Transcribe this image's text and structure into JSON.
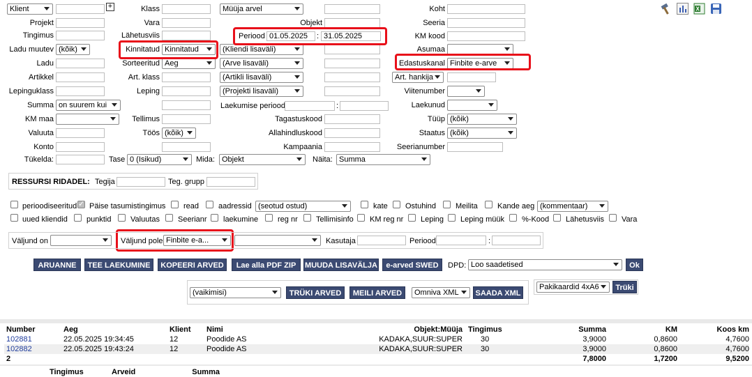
{
  "filters": {
    "klient": {
      "label": "Klient",
      "value": ""
    },
    "projekt": {
      "label": "Projekt",
      "value": ""
    },
    "tingimus": {
      "label": "Tingimus",
      "value": ""
    },
    "ladu_muutev": {
      "label": "Ladu muutev",
      "value": "(kõik)"
    },
    "ladu": {
      "label": "Ladu",
      "value": ""
    },
    "artikkel": {
      "label": "Artikkel",
      "value": ""
    },
    "lepinguklass": {
      "label": "Lepinguklass",
      "value": ""
    },
    "summa": {
      "label": "Summa",
      "value": "on suurem kui"
    },
    "km_maa": {
      "label": "KM maa",
      "value": ""
    },
    "valuuta": {
      "label": "Valuuta",
      "value": ""
    },
    "konto": {
      "label": "Konto",
      "value": ""
    },
    "klass": {
      "label": "Klass",
      "value": ""
    },
    "vara": {
      "label": "Vara",
      "value": ""
    },
    "lahetusviis": {
      "label": "Lähetusviis",
      "value": ""
    },
    "kinnitatud": {
      "label": "Kinnitatud",
      "value": "Kinnitatud"
    },
    "sorteeritud": {
      "label": "Sorteeritud",
      "value": "Aeg"
    },
    "art_klass": {
      "label": "Art. klass",
      "value": ""
    },
    "leping": {
      "label": "Leping",
      "value": ""
    },
    "tellimus": {
      "label": "Tellimus",
      "value": ""
    },
    "toos": {
      "label": "Töös",
      "value": "(kõik)"
    },
    "muuja_arvel": {
      "value": "Müüja arvel"
    },
    "objekt": {
      "label": "Objekt",
      "value": ""
    },
    "periood": {
      "label": "Periood",
      "from": "01.05.2025",
      "to": "31.05.2025"
    },
    "kliendi_lisavali": {
      "value": "(Kliendi lisaväli)"
    },
    "arve_lisavali": {
      "value": "(Arve lisaväli)"
    },
    "artikli_lisavali": {
      "value": "(Artikli lisaväli)"
    },
    "projekti_lisavali": {
      "value": "(Projekti lisaväli)"
    },
    "laekumise_periood": {
      "label": "Laekumise periood"
    },
    "tagastuskood": {
      "label": "Tagastuskood"
    },
    "allahindluskood": {
      "label": "Allahindluskood"
    },
    "kampaania": {
      "label": "Kampaania"
    },
    "koht": {
      "label": "Koht"
    },
    "seeria": {
      "label": "Seeria"
    },
    "km_kood": {
      "label": "KM kood"
    },
    "asumaa": {
      "label": "Asumaa",
      "value": ""
    },
    "edastuskanal": {
      "label": "Edastuskanal",
      "value": "Finbite e-arve"
    },
    "art_hankija": {
      "value": "Art. hankija"
    },
    "viitenumber": {
      "label": "Viitenumber",
      "value": ""
    },
    "laekunud": {
      "label": "Laekunud",
      "value": ""
    },
    "tuup": {
      "label": "Tüüp",
      "value": "(kõik)"
    },
    "staatus": {
      "label": "Staatus",
      "value": "(kõik)"
    },
    "seerianumber": {
      "label": "Seerianumber"
    },
    "tukelda": {
      "label": "Tükelda:",
      "value": ""
    },
    "tase": {
      "label": "Tase",
      "value": "0 (Isikud)"
    },
    "mida": {
      "label": "Mida:",
      "value": "Objekt"
    },
    "naita": {
      "label": "Näita:",
      "value": "Summa"
    }
  },
  "ressursi": {
    "title": "RESSURSI RIDADEL:",
    "tegija": "Tegija",
    "teg_grupp": "Teg. grupp"
  },
  "options": {
    "row1": [
      {
        "label": "perioodiseeritud",
        "checked": false
      },
      {
        "label": "Päise tasumistingimus",
        "checked": true
      },
      {
        "label": "read",
        "checked": false
      },
      {
        "label": "aadressid",
        "checked": false
      },
      {
        "label": "kate",
        "checked": false
      },
      {
        "label": "Ostuhind",
        "checked": false
      },
      {
        "label": "Meilita",
        "checked": false
      },
      {
        "label": "Kande aeg",
        "checked": false
      }
    ],
    "seotud_ostud": "(seotud ostud)",
    "kommentaar": "(kommentaar)",
    "row2": [
      {
        "label": "uued kliendid",
        "checked": false
      },
      {
        "label": "punktid",
        "checked": false
      },
      {
        "label": "Valuutas",
        "checked": false
      },
      {
        "label": "Seerianr",
        "checked": false
      },
      {
        "label": "laekumine",
        "checked": false
      },
      {
        "label": "reg nr",
        "checked": false
      },
      {
        "label": "Tellimisinfo",
        "checked": false
      },
      {
        "label": "KM reg nr",
        "checked": false
      },
      {
        "label": "Leping",
        "checked": false
      },
      {
        "label": "Leping müük",
        "checked": false
      },
      {
        "label": "%-Kood",
        "checked": false
      },
      {
        "label": "Lähetusviis",
        "checked": false
      },
      {
        "label": "Vara",
        "checked": false
      }
    ]
  },
  "output": {
    "valjund_on": "Väljund on",
    "valjund_on_value": "",
    "valjund_pole": "Väljund pole",
    "valjund_pole_value": "Finbite e-a...",
    "extra_value": "",
    "kasutaja": "Kasutaja",
    "periood": "Periood"
  },
  "actions": {
    "aruanne": "ARUANNE",
    "tee_laekumine": "TEE LAEKUMINE",
    "kopeeri_arved": "KOPEERI ARVED",
    "lae_alla_pdf": "Lae alla PDF ZIP",
    "muuda_lisavalja": "MUUDA LISAVÄLJA",
    "e_arved_swed": "e-arved SWED",
    "dpd_label": "DPD:",
    "dpd_value": "Loo saadetised",
    "ok": "Ok"
  },
  "print": {
    "template": "(vaikimisi)",
    "truki_arved": "TRÜKI ARVED",
    "meili_arved": "MEILI ARVED",
    "format": "Omniva XML",
    "saada_xml": "SAADA XML",
    "pakikaardid": "Pakikaardid 4xA6",
    "truki": "Trüki"
  },
  "table": {
    "headers": {
      "number": "Number",
      "aeg": "Aeg",
      "klient": "Klient",
      "nimi": "Nimi",
      "objekt": "Objekt:Müüja",
      "tingimus": "Tingimus",
      "summa": "Summa",
      "km": "KM",
      "koos_km": "Koos km"
    },
    "rows": [
      {
        "number": "102881",
        "aeg": "22.05.2025 19:34:45",
        "klient": "12",
        "nimi": "Poodide AS",
        "objekt": "KADAKA,SUUR:SUPER",
        "tingimus": "30",
        "summa": "3,9000",
        "km": "0,8600",
        "koos_km": "4,7600"
      },
      {
        "number": "102882",
        "aeg": "22.05.2025 19:43:24",
        "klient": "12",
        "nimi": "Poodide AS",
        "objekt": "KADAKA,SUUR:SUPER",
        "tingimus": "30",
        "summa": "3,9000",
        "km": "0,8600",
        "koos_km": "4,7600"
      }
    ],
    "total": {
      "count": "2",
      "summa": "7,8000",
      "km": "1,7200",
      "koos_km": "9,5200"
    },
    "summary_headers": {
      "tingimus": "Tingimus",
      "arveid": "Arveid",
      "summa": "Summa"
    }
  },
  "colors": {
    "highlight": "#e8101a",
    "button": "#3b4a72",
    "link": "#1f3c9c"
  }
}
